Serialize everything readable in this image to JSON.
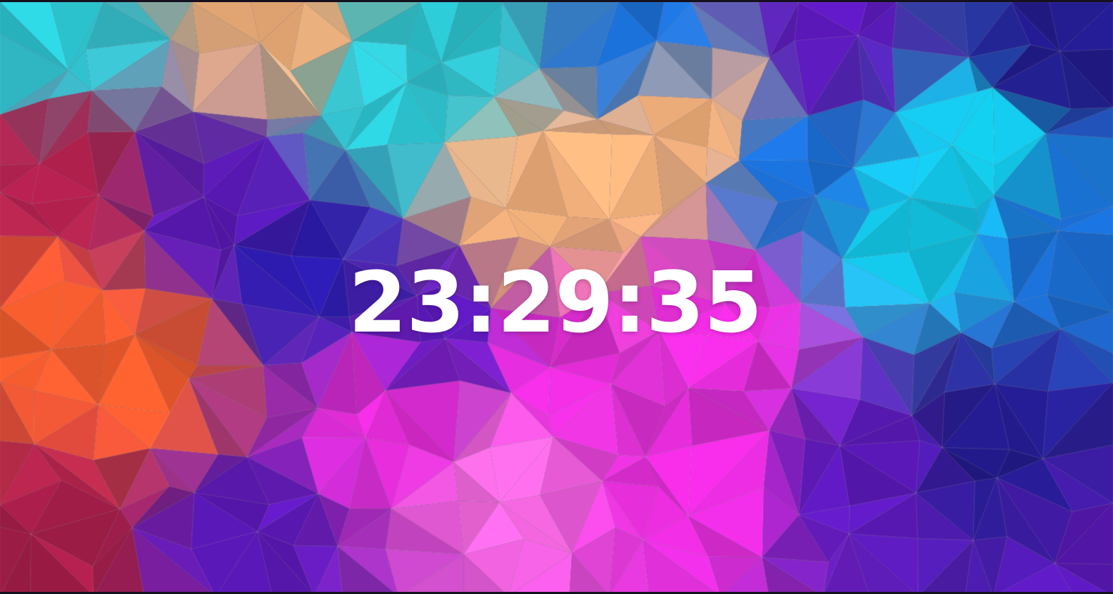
{
  "clock": {
    "time": "23:29:35"
  },
  "wallpaper": {
    "icon": "low-poly-gradient-wallpaper",
    "palette": {
      "teal": "#2bc4d0",
      "cyan": "#12c8e6",
      "blue": "#1a6fd6",
      "deep_indigo": "#2a1aa8",
      "violet": "#5a18b8",
      "magenta": "#e22ad6",
      "pink": "#f56ae0",
      "peach": "#f2b07a",
      "orange": "#ee5a2c",
      "crimson": "#a81e4a",
      "navy": "#221a8a"
    }
  },
  "frame": {
    "border_color": "#15101e"
  }
}
